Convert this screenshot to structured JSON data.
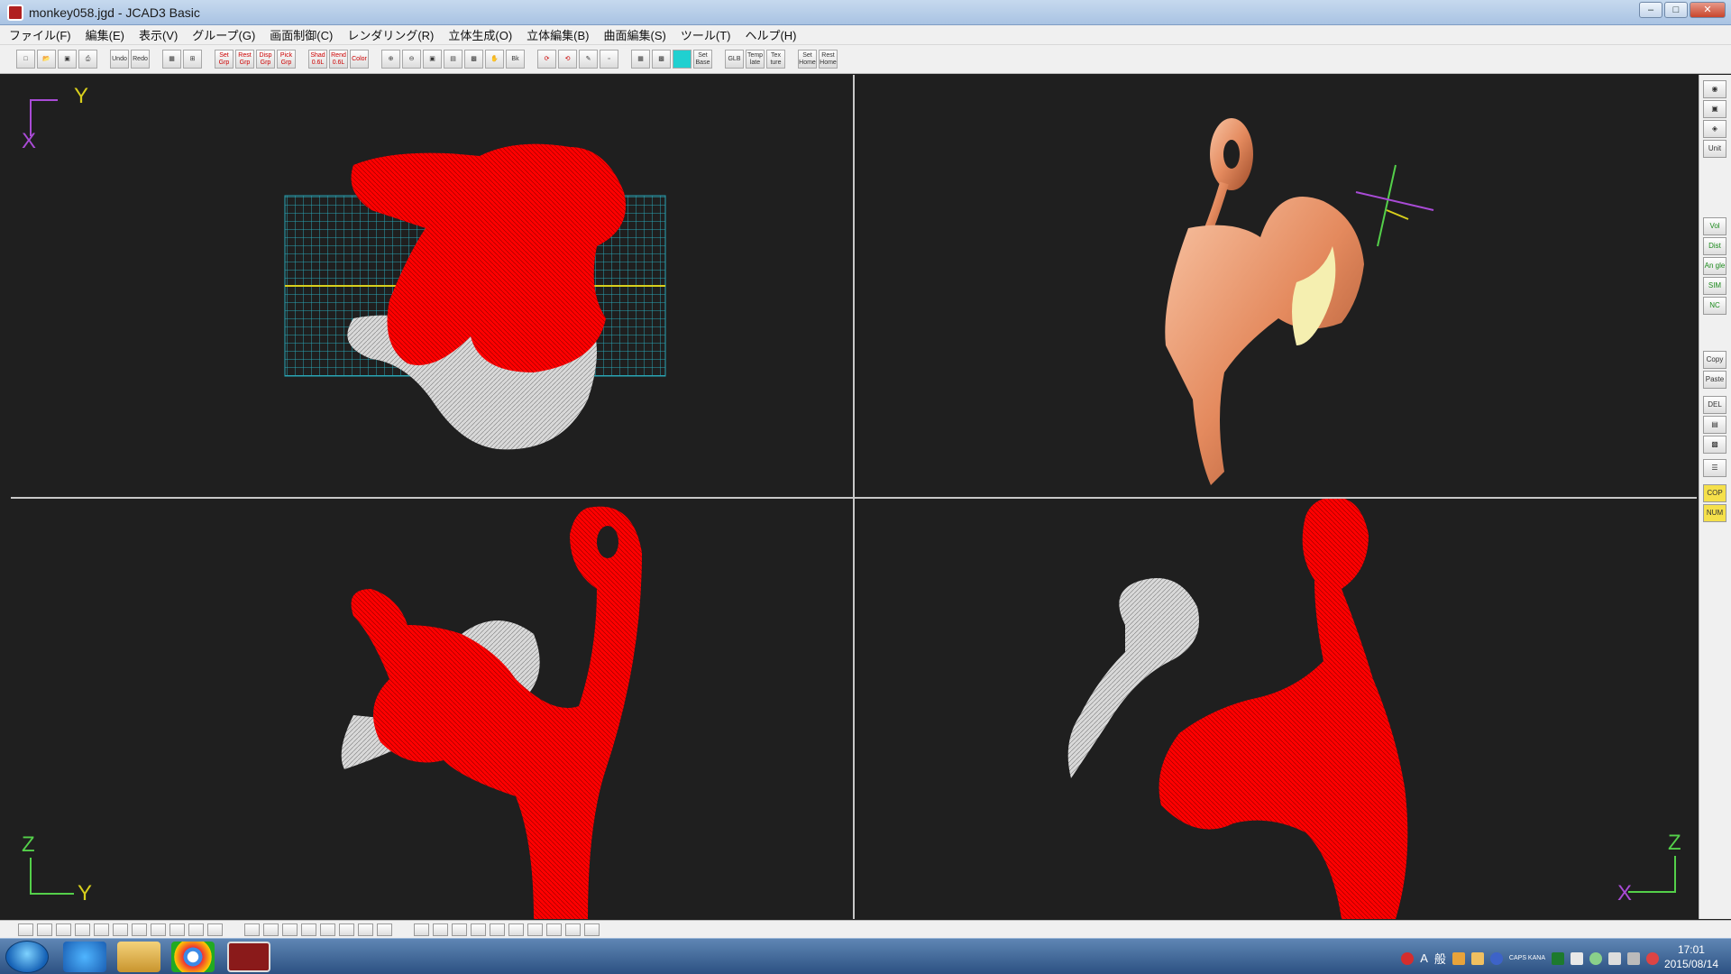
{
  "window": {
    "title": "monkey058.jgd - JCAD3 Basic",
    "buttons": [
      "–",
      "□",
      "✕"
    ]
  },
  "menu": [
    "ファイル(F)",
    "編集(E)",
    "表示(V)",
    "グループ(G)",
    "画面制御(C)",
    "レンダリング(R)",
    "立体生成(O)",
    "立体編集(B)",
    "曲面編集(S)",
    "ツール(T)",
    "ヘルプ(H)"
  ],
  "toolbar": {
    "groups": [
      [
        "",
        "",
        "",
        ""
      ],
      [
        "Undo",
        "Redo"
      ],
      [
        "",
        ""
      ],
      [
        "Set Grp",
        "Rest Grp",
        "Disp Grp",
        "Pick Grp"
      ],
      [
        "Shad 0.6L",
        "Rend 0.6L",
        "Color"
      ],
      [
        "",
        "",
        "",
        "",
        "",
        "",
        "Bk"
      ],
      [
        "",
        "",
        "",
        ""
      ],
      [
        "",
        "",
        "",
        "Set Base"
      ],
      [
        "GLB",
        "Temp late",
        "Tex ture"
      ],
      [
        "Set Home",
        "Rest Home"
      ]
    ]
  },
  "viewports": {
    "top_left": {
      "axes": [
        "Y",
        "X"
      ]
    },
    "top_right": {
      "axes": []
    },
    "bottom_left": {
      "axes": [
        "Z",
        "Y"
      ]
    },
    "bottom_right": {
      "axes": [
        "Z",
        "X"
      ]
    }
  },
  "right_panel": {
    "buttons": [
      "",
      "",
      "",
      "Unit",
      "Vol ume",
      "Dist ance",
      "An gle",
      "SIM",
      "NC Disp",
      "Copy",
      "Paste",
      "DEL",
      "",
      "",
      "",
      "COP",
      "NUM"
    ]
  },
  "taskbar": {
    "tray_text": [
      "A",
      "般"
    ],
    "tray_caps": "CAPS KANA",
    "time": "17:01",
    "date": "2015/08/14"
  },
  "colors": {
    "viewport_bg": "#1f1f1f",
    "wire_red": "#ff0000",
    "wire_white": "#d9d9d9",
    "copper": "#e89a72",
    "grid": "#2aa6b4",
    "axis_yellow": "#d8cf1c",
    "axis_purple": "#a94bd6",
    "axis_green": "#54d04a"
  }
}
